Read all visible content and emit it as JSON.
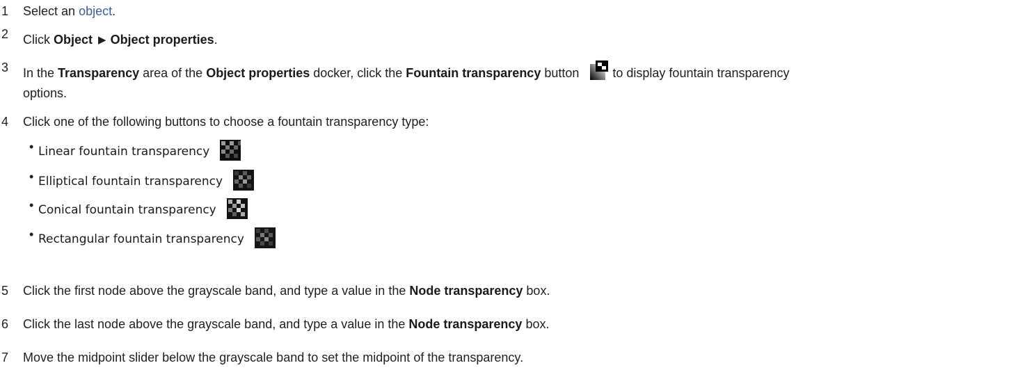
{
  "steps": [
    {
      "num": "1",
      "pre": "Select an ",
      "link": "object",
      "post": "."
    },
    {
      "num": "2",
      "pre": "Click ",
      "b1": "Object",
      "b2": "Object properties",
      "post": "."
    },
    {
      "num": "3",
      "pre": "In the ",
      "b1": "Transparency",
      "mid1": " area of the ",
      "b2": "Object properties",
      "mid2": " docker, click the ",
      "b3": "Fountain transparency",
      "mid3": " button",
      "post_line1": "to display fountain transparency",
      "post_line2": "options."
    },
    {
      "num": "4",
      "text": "Click one of the following buttons to choose a fountain transparency type:"
    },
    {
      "num": "5",
      "pre": "Click the first node above the grayscale band, and type a value in the ",
      "b1": "Node transparency",
      "post": " box."
    },
    {
      "num": "6",
      "pre": "Click the last node above the grayscale band, and type a value in the ",
      "b1": "Node transparency",
      "post": " box."
    },
    {
      "num": "7",
      "text": "Move the midpoint slider below the grayscale band to set the midpoint of the transparency."
    }
  ],
  "options": [
    {
      "label": "Linear fountain transparency",
      "icon": "linear-fountain-icon"
    },
    {
      "label": "Elliptical fountain transparency",
      "icon": "elliptical-fountain-icon"
    },
    {
      "label": "Conical fountain transparency",
      "icon": "conical-fountain-icon"
    },
    {
      "label": "Rectangular fountain transparency",
      "icon": "rectangular-fountain-icon"
    }
  ],
  "colors": {
    "link": "#3b5f9c",
    "text": "#1f1f1f"
  }
}
